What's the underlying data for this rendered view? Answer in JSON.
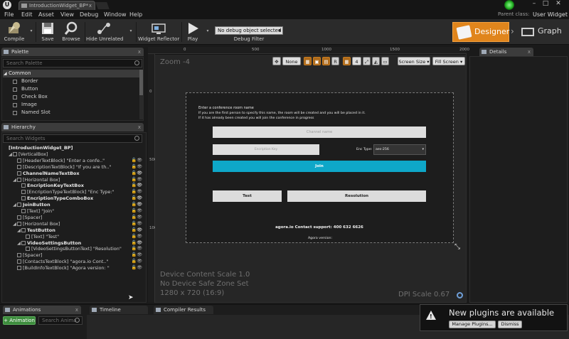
{
  "title_bar": {
    "tab_title": "IntroductionWidget_BP*",
    "close_glyph": "x",
    "window_min": "–",
    "window_max": "□",
    "window_close": "✕"
  },
  "menu": {
    "items": [
      "File",
      "Edit",
      "Asset",
      "View",
      "Debug",
      "Window",
      "Help"
    ],
    "parent_class_label": "Parent class:",
    "parent_class_value": "User Widget"
  },
  "toolbar": {
    "compile": "Compile",
    "save": "Save",
    "browse": "Browse",
    "hide_unrelated": "Hide Unrelated",
    "widget_reflector": "Widget Reflector",
    "play": "Play",
    "debug_object": "No debug object selected",
    "debug_filter": "Debug Filter",
    "designer": "Designer",
    "graph": "Graph",
    "accent_color": "#e0851c"
  },
  "palette": {
    "tab": "Palette",
    "search_placeholder": "Search Palette",
    "category": "Common",
    "items": [
      "Border",
      "Button",
      "Check Box",
      "Image",
      "Named Slot"
    ]
  },
  "hierarchy": {
    "tab": "Hierarchy",
    "search_placeholder": "Search Widgets",
    "rows": [
      {
        "label": "[IntroductionWidget_BP]",
        "indent": 0,
        "bold": true,
        "twisty": ""
      },
      {
        "label": "[VerticalBox]",
        "indent": 1,
        "bold": false,
        "twisty": "◢"
      },
      {
        "label": "[HeaderTextBlock] \"Enter a confe..\"",
        "indent": 2,
        "bold": false,
        "twisty": ""
      },
      {
        "label": "[DescriptionTextBlock] \"If you are th..\"",
        "indent": 2,
        "bold": false,
        "twisty": ""
      },
      {
        "label": "ChannelNameTextBox",
        "indent": 2,
        "bold": true,
        "twisty": ""
      },
      {
        "label": "[Horizontal Box]",
        "indent": 2,
        "bold": false,
        "twisty": "◢"
      },
      {
        "label": "EncriptionKeyTextBox",
        "indent": 3,
        "bold": true,
        "twisty": ""
      },
      {
        "label": "[EncriptionTypeTextBlock] \"Enc Type:\"",
        "indent": 3,
        "bold": false,
        "twisty": ""
      },
      {
        "label": "EncriptionTypeComboBox",
        "indent": 3,
        "bold": true,
        "twisty": ""
      },
      {
        "label": "JoinButton",
        "indent": 2,
        "bold": true,
        "twisty": "◢"
      },
      {
        "label": "[Text] \"Join\"",
        "indent": 3,
        "bold": false,
        "twisty": ""
      },
      {
        "label": "[Spacer]",
        "indent": 2,
        "bold": false,
        "twisty": ""
      },
      {
        "label": "[Horizontal Box]",
        "indent": 2,
        "bold": false,
        "twisty": "◢"
      },
      {
        "label": "TestButton",
        "indent": 3,
        "bold": true,
        "twisty": "◢"
      },
      {
        "label": "[Text] \"Test\"",
        "indent": 4,
        "bold": false,
        "twisty": ""
      },
      {
        "label": "VideoSettingsButton",
        "indent": 3,
        "bold": true,
        "twisty": "◢"
      },
      {
        "label": "[VideoSettingsButtonText] \"Resolution\"",
        "indent": 4,
        "bold": false,
        "twisty": ""
      },
      {
        "label": "[Spacer]",
        "indent": 2,
        "bold": false,
        "twisty": ""
      },
      {
        "label": "[ContactsTextBlock] \"agora.io Cont..\"",
        "indent": 2,
        "bold": false,
        "twisty": ""
      },
      {
        "label": "[BuildInfoTextBlock] \"Agora version: \"",
        "indent": 2,
        "bold": false,
        "twisty": ""
      }
    ]
  },
  "viewport": {
    "zoom": "Zoom -4",
    "ruler_top": [
      "0",
      "500",
      "1000",
      "1500",
      "2000"
    ],
    "ruler_left": [
      "0",
      "500",
      "1000"
    ],
    "toolbar": {
      "none": "None",
      "r": "R",
      "grid": "4",
      "screen_size": "Screen Size",
      "fill_screen": "Fill Screen"
    },
    "device_content_scale": "Device Content Scale 1.0",
    "safe_zone": "No Device Safe Zone Set",
    "resolution": "1280 x 720 (16:9)",
    "dpi_scale": "DPI Scale 0.67"
  },
  "widget": {
    "header": "Enter a conference room name",
    "description_1": "If you are the first person to specify this name, the room will be created and you will be placed in it.",
    "description_2": "If it has already been created you will join the conference in progress",
    "channel_placeholder": "Channel name",
    "encryption_key_placeholder": "Encription Key",
    "enc_type_label": "Enc Type:",
    "enc_type_value": "aes-256",
    "join": "Join",
    "test": "Test",
    "resolution": "Resolution",
    "contact": "agora.io Contact support: 400 632 6626",
    "version": "Agora version:",
    "join_color": "#0ea7c8"
  },
  "details": {
    "tab": "Details"
  },
  "bottom": {
    "tab_animations": "Animations",
    "tab_timeline": "Timeline",
    "tab_compiler": "Compiler Results",
    "add_animation": "+ Animation",
    "search_placeholder": "Search Anima"
  },
  "notification": {
    "title": "New plugins are available",
    "manage": "Manage Plugins...",
    "dismiss": "Dismiss"
  }
}
